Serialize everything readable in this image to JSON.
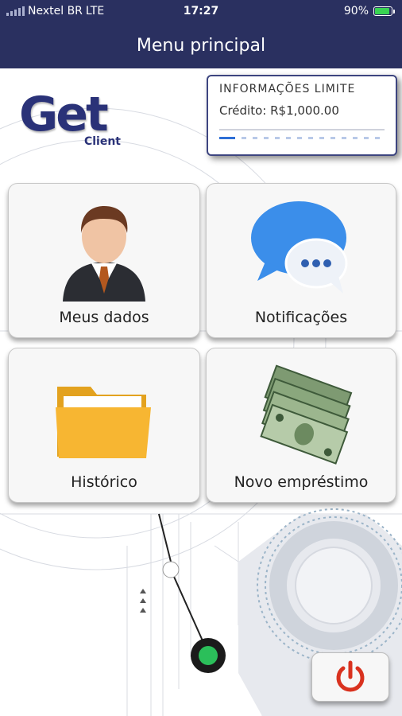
{
  "status_bar": {
    "carrier": "Nextel BR",
    "network": "LTE",
    "time": "17:27",
    "battery": "90%",
    "battery_level": 0.9
  },
  "navbar": {
    "title": "Menu principal"
  },
  "logo": {
    "main": "Get",
    "sub": "Client"
  },
  "limit": {
    "title": "INFORMAÇÕES LIMITE",
    "credit": "Crédito: R$1,000.00"
  },
  "tiles": [
    {
      "label": "Meus dados",
      "icon": "user-profile-icon"
    },
    {
      "label": "Notificações",
      "icon": "chat-bubble-icon"
    },
    {
      "label": "Histórico",
      "icon": "folder-icon"
    },
    {
      "label": "Novo empréstimo",
      "icon": "money-stack-icon"
    }
  ],
  "power": {
    "icon": "power-icon"
  },
  "colors": {
    "header": "#2a3060",
    "brand": "#2a3278",
    "power": "#d9321f",
    "chat": "#3b8eea",
    "folder": "#f7b632"
  }
}
